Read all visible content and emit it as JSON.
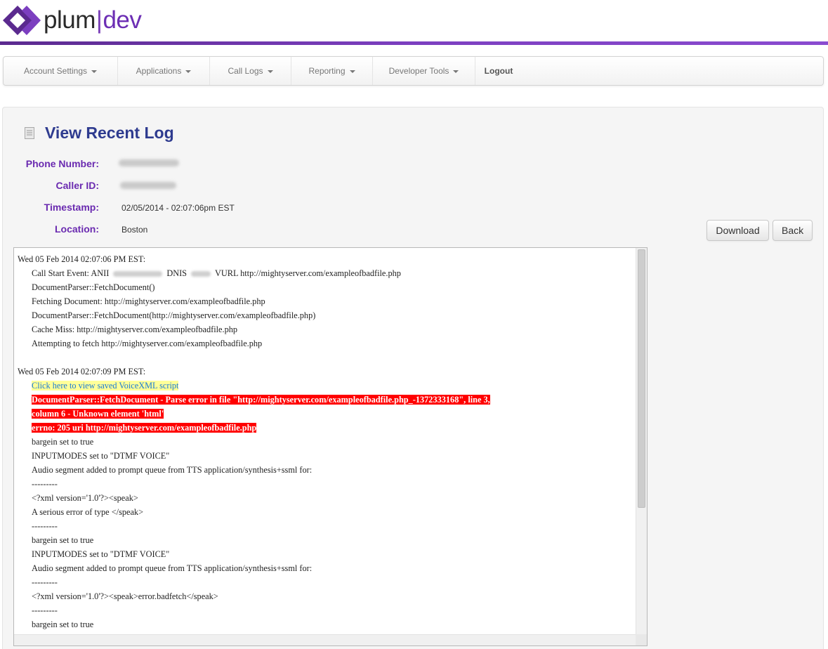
{
  "brand": {
    "plum": "plum",
    "sep": "|",
    "dev": "dev",
    "colors": {
      "logo": "#5b2a8f",
      "rule": "#7c3fc0"
    }
  },
  "nav": {
    "items": [
      {
        "label": "Account Settings",
        "dropdown": true
      },
      {
        "label": "Applications",
        "dropdown": true
      },
      {
        "label": "Call Logs",
        "dropdown": true
      },
      {
        "label": "Reporting",
        "dropdown": true
      },
      {
        "label": "Developer Tools",
        "dropdown": true
      },
      {
        "label": "Logout",
        "dropdown": false
      }
    ]
  },
  "page": {
    "title": "View Recent Log",
    "icon": "document-icon",
    "fields": {
      "phone_number_label": "Phone Number:",
      "caller_id_label": "Caller ID:",
      "timestamp_label": "Timestamp:",
      "timestamp_value": "02/05/2014 - 02:07:06pm EST",
      "location_label": "Location:",
      "location_value": "Boston"
    },
    "buttons": {
      "download": "Download",
      "back": "Back"
    }
  },
  "log": {
    "lines": [
      {
        "text": "Wed 05 Feb 2014 02:07:06 PM EST:",
        "indent": false
      },
      {
        "text": "Call Start Event: ANII",
        "after_blur": "DNIS",
        "after_blur2": "VURL http://mightyserver.com/exampleofbadfile.php",
        "indent": true,
        "redacted": true
      },
      {
        "text": "DocumentParser::FetchDocument()",
        "indent": true
      },
      {
        "text": "Fetching Document: http://mightyserver.com/exampleofbadfile.php",
        "indent": true
      },
      {
        "text": "DocumentParser::FetchDocument(http://mightyserver.com/exampleofbadfile.php)",
        "indent": true
      },
      {
        "text": "Cache Miss: http://mightyserver.com/exampleofbadfile.php",
        "indent": true
      },
      {
        "text": "Attempting to fetch http://mightyserver.com/exampleofbadfile.php",
        "indent": true
      },
      {
        "text": "",
        "indent": false
      },
      {
        "text": "Wed 05 Feb 2014 02:07:09 PM EST:",
        "indent": false
      },
      {
        "text": "Click here to view saved VoiceXML script",
        "indent": true,
        "style": "link"
      },
      {
        "text": "DocumentParser::FetchDocument - Parse error in file \"http://mightyserver.com/exampleofbadfile.php_-1372333168\", line 3,",
        "indent": true,
        "style": "error"
      },
      {
        "text": "column 6 - Unknown element 'html'",
        "indent": true,
        "style": "error"
      },
      {
        "text": "errno: 205 uri http://mightyserver.com/exampleofbadfile.php",
        "indent": true,
        "style": "error"
      },
      {
        "text": "bargein set to true",
        "indent": true
      },
      {
        "text": "INPUTMODES set to \"DTMF VOICE\"",
        "indent": true
      },
      {
        "text": "Audio segment added to prompt queue from TTS application/synthesis+ssml for:",
        "indent": true
      },
      {
        "text": "---------",
        "indent": true
      },
      {
        "text": "<?xml version='1.0'?><speak>",
        "indent": true
      },
      {
        "text": "A serious error of type </speak>",
        "indent": true
      },
      {
        "text": "---------",
        "indent": true
      },
      {
        "text": "bargein set to true",
        "indent": true
      },
      {
        "text": "INPUTMODES set to \"DTMF VOICE\"",
        "indent": true
      },
      {
        "text": "Audio segment added to prompt queue from TTS application/synthesis+ssml for:",
        "indent": true
      },
      {
        "text": "---------",
        "indent": true
      },
      {
        "text": "<?xml version='1.0'?><speak>error.badfetch</speak>",
        "indent": true
      },
      {
        "text": "---------",
        "indent": true
      },
      {
        "text": "bargein set to true",
        "indent": true
      }
    ]
  }
}
